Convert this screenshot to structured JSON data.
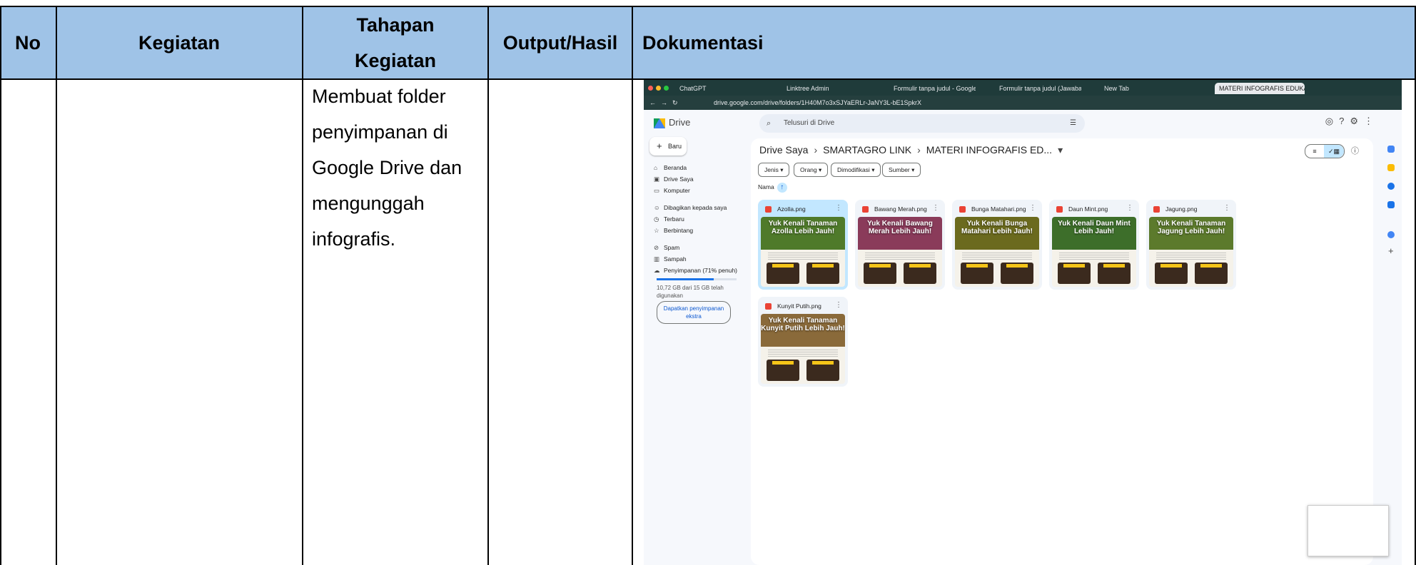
{
  "table": {
    "headers": {
      "no": "No",
      "kegiatan": "Kegiatan",
      "tahapan": "Tahapan Kegiatan",
      "output": "Output/Hasil",
      "dokumentasi": "Dokumentasi"
    },
    "row": {
      "tahapan_text": "Membuat folder penyimpanan di Google Drive dan mengunggah infografis."
    }
  },
  "browser": {
    "tabs": [
      {
        "label": "ChatGPT"
      },
      {
        "label": "Linktree Admin"
      },
      {
        "label": "Formulir tanpa judul - Google"
      },
      {
        "label": "Formulir tanpa judul (Jawaba"
      },
      {
        "label": "New Tab"
      },
      {
        "label": "MATERI INFOGRAFIS EDUKA"
      }
    ],
    "url": "drive.google.com/drive/folders/1H40M7o3xSJYaERLr-JaNY3L-bE1SpkrX"
  },
  "drive": {
    "logo_label": "Drive",
    "search_placeholder": "Telusuri di Drive",
    "new_label": "Baru",
    "nav": [
      {
        "label": "Beranda",
        "icon": "home-icon"
      },
      {
        "label": "Drive Saya",
        "icon": "drive-icon"
      },
      {
        "label": "Komputer",
        "icon": "computer-icon"
      },
      {
        "label": "Dibagikan kepada saya",
        "icon": "people-icon"
      },
      {
        "label": "Terbaru",
        "icon": "clock-icon"
      },
      {
        "label": "Berbintang",
        "icon": "star-icon"
      },
      {
        "label": "Spam",
        "icon": "spam-icon"
      },
      {
        "label": "Sampah",
        "icon": "trash-icon"
      },
      {
        "label": "Penyimpanan (71% penuh)",
        "icon": "cloud-icon"
      }
    ],
    "storage_used": 0.71,
    "storage_text": "10,72 GB dari 15 GB telah digunakan",
    "get_more": "Dapatkan penyimpanan ekstra",
    "breadcrumb": [
      "Drive Saya",
      "SMARTAGRO LINK",
      "MATERI INFOGRAFIS ED..."
    ],
    "filters": [
      "Jenis",
      "Orang",
      "Dimodifikasi",
      "Sumber"
    ],
    "sort_label": "Nama",
    "files": [
      {
        "name": "Azolla.png",
        "title": "Yuk Kenali Tanaman Azolla Lebih Jauh!",
        "color": "#4f7a2a"
      },
      {
        "name": "Bawang Merah.png",
        "title": "Yuk Kenali Bawang Merah Lebih Jauh!",
        "color": "#8a3b5a"
      },
      {
        "name": "Bunga Matahari.png",
        "title": "Yuk Kenali Bunga Matahari Lebih Jauh!",
        "color": "#6b6a1e"
      },
      {
        "name": "Daun Mint.png",
        "title": "Yuk Kenali Daun Mint Lebih Jauh!",
        "color": "#3d6e2a"
      },
      {
        "name": "Jagung.png",
        "title": "Yuk Kenali Tanaman Jagung Lebih Jauh!",
        "color": "#5c7a2c"
      },
      {
        "name": "Kunyit Putih.png",
        "title": "Yuk Kenali Tanaman Kunyit Putih Lebih Jauh!",
        "color": "#8a6a3a"
      }
    ]
  }
}
